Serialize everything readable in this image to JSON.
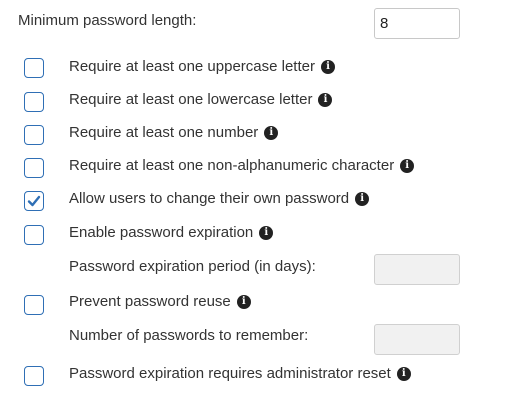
{
  "min_length": {
    "label": "Minimum password length:",
    "value": "8"
  },
  "options": [
    {
      "label": "Require at least one uppercase letter",
      "checked": false,
      "info_icon": "info-icon"
    },
    {
      "label": "Require at least one lowercase letter",
      "checked": false,
      "info_icon": "info-icon"
    },
    {
      "label": "Require at least one number",
      "checked": false,
      "info_icon": "info-icon"
    },
    {
      "label": "Require at least one non-alphanumeric character",
      "checked": false,
      "info_icon": "info-icon"
    },
    {
      "label": "Allow users to change their own password",
      "checked": true,
      "info_icon": "info-icon"
    },
    {
      "label": "Enable password expiration",
      "checked": false,
      "info_icon": "info-icon"
    },
    {
      "label": "Prevent password reuse",
      "checked": false,
      "info_icon": "info-icon"
    },
    {
      "label": "Password expiration requires administrator reset",
      "checked": false,
      "info_icon": "info-icon"
    }
  ],
  "expiration_period": {
    "label": "Password expiration period (in days):",
    "value": ""
  },
  "reuse_count": {
    "label": "Number of passwords to remember:",
    "value": ""
  },
  "colors": {
    "checkbox_border": "#2f6fb5",
    "checkmark": "#2f6fb5",
    "text": "#333333",
    "disabled_input_bg": "#f1f1f1"
  }
}
